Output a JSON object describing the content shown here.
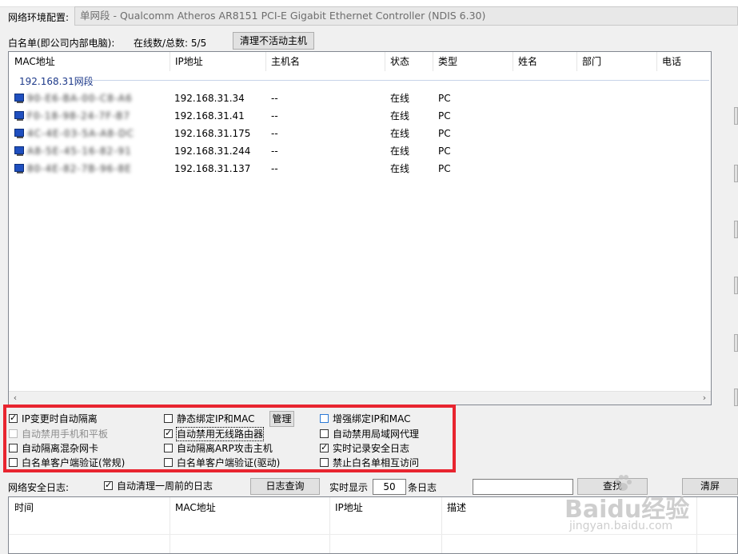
{
  "network_config": {
    "label": "网络环境配置:",
    "value": "单网段 - Qualcomm Atheros AR8151 PCI-E Gigabit Ethernet Controller (NDIS 6.30)"
  },
  "whitelist": {
    "label": "白名单(即公司内部电脑):",
    "online_total": "在线数/总数:  5/5",
    "clear_button": "清理不活动主机",
    "columns": [
      "MAC地址",
      "IP地址",
      "主机名",
      "状态",
      "类型",
      "姓名",
      "部门",
      "电话"
    ],
    "group_title": "192.168.31网段",
    "rows": [
      {
        "mac": "90-E6-BA-00-C8-A6",
        "ip": "192.168.31.34",
        "host": "--",
        "status": "在线",
        "type": "PC"
      },
      {
        "mac": "F0-18-98-24-7F-B7",
        "ip": "192.168.31.41",
        "host": "--",
        "status": "在线",
        "type": "PC"
      },
      {
        "mac": "4C-4E-03-5A-A8-DC",
        "ip": "192.168.31.175",
        "host": "--",
        "status": "在线",
        "type": "PC"
      },
      {
        "mac": "A8-5E-45-16-82-91",
        "ip": "192.168.31.244",
        "host": "--",
        "status": "在线",
        "type": "PC"
      },
      {
        "mac": "80-4E-82-7B-96-8E",
        "ip": "192.168.31.137",
        "host": "--",
        "status": "在线",
        "type": "PC"
      }
    ]
  },
  "options": {
    "col1": [
      {
        "label": "IP变更时自动隔离",
        "checked": true,
        "disabled": false
      },
      {
        "label": "自动禁用手机和平板",
        "checked": false,
        "disabled": true
      },
      {
        "label": "自动隔离混杂网卡",
        "checked": false,
        "disabled": false
      },
      {
        "label": "白名单客户端验证(常规)",
        "checked": false,
        "disabled": false
      }
    ],
    "col2": [
      {
        "label": "静态绑定IP和MAC",
        "checked": false,
        "disabled": false
      },
      {
        "label": "自动禁用无线路由器",
        "checked": true,
        "disabled": false
      },
      {
        "label": "自动隔离ARP攻击主机",
        "checked": false,
        "disabled": false
      },
      {
        "label": "白名单客户端验证(驱动)",
        "checked": false,
        "disabled": false
      }
    ],
    "col3": [
      {
        "label": "增强绑定IP和MAC",
        "checked": false,
        "disabled": false
      },
      {
        "label": "自动禁用局域网代理",
        "checked": false,
        "disabled": false
      },
      {
        "label": "实时记录安全日志",
        "checked": true,
        "disabled": false
      },
      {
        "label": "禁止白名单相互访问",
        "checked": false,
        "disabled": false
      }
    ],
    "manage_button": "管理"
  },
  "security_log": {
    "label": "网络安全日志:",
    "auto_clear_label": "自动清理一周前的日志",
    "auto_clear_checked": true,
    "query_button": "日志查询",
    "realtime_label": "实时显示",
    "realtime_count": "50",
    "count_suffix": "条日志",
    "search_button": "查找",
    "clear_button": "清屏",
    "columns": [
      "时间",
      "MAC地址",
      "IP地址",
      "描述"
    ]
  },
  "watermark": {
    "brand": "Baidu经验",
    "url": "jingyan.baidu.com"
  },
  "colors": {
    "highlight_border": "#e8252f",
    "group_title": "#1e3a8a",
    "pc_icon": "#1f4fbf"
  }
}
